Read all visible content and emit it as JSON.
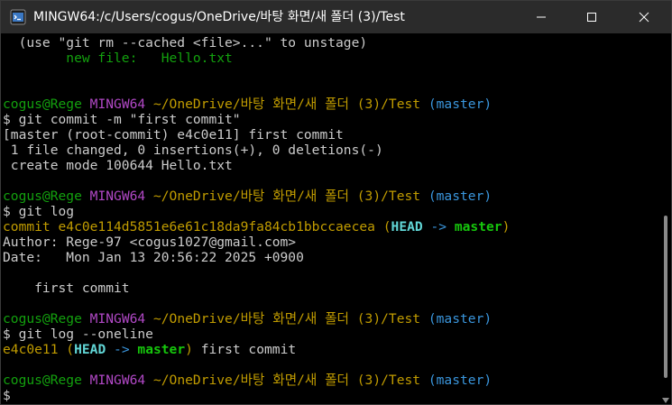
{
  "window": {
    "title": "MINGW64:/c/Users/cogus/OneDrive/바탕 화면/새 폴더 (3)/Test",
    "app_icon": "mingw-terminal-icon",
    "buttons": {
      "minimize": "minimize-icon",
      "maximize": "maximize-icon",
      "close": "close-icon"
    }
  },
  "colors": {
    "background": "#000000",
    "text": "#cccccc",
    "user_host": "#13a10e",
    "mingw": "#b148c6",
    "path": "#c19c00",
    "branch": "#3a96dd",
    "head": "#61d6d6",
    "master": "#16c60c"
  },
  "terminal": {
    "unstage_hint": "  (use \"git rm --cached <file>...\" to unstage)",
    "new_file_label": "        new file:   ",
    "new_file_name": "Hello.txt",
    "prompts": [
      {
        "user_host": "cogus@Rege",
        "shell": "MINGW64",
        "path": "~/OneDrive/바탕 화면/새 폴더 (3)/Test",
        "branch": "(master)"
      },
      {
        "user_host": "cogus@Rege",
        "shell": "MINGW64",
        "path": "~/OneDrive/바탕 화면/새 폴더 (3)/Test",
        "branch": "(master)"
      },
      {
        "user_host": "cogus@Rege",
        "shell": "MINGW64",
        "path": "~/OneDrive/바탕 화면/새 폴더 (3)/Test",
        "branch": "(master)"
      },
      {
        "user_host": "cogus@Rege",
        "shell": "MINGW64",
        "path": "~/OneDrive/바탕 화면/새 폴더 (3)/Test",
        "branch": "(master)"
      }
    ],
    "cmd_commit": "$ git commit -m \"first commit\"",
    "commit_out_1": "[master (root-commit) e4c0e11] first commit",
    "commit_out_2": " 1 file changed, 0 insertions(+), 0 deletions(-)",
    "commit_out_3": " create mode 100644 Hello.txt",
    "cmd_log": "$ git log",
    "log_commit_prefix": "commit e4c0e114d5851e6e61c18da9fa84cb1bbccaecea",
    "log_open_paren": " (",
    "log_head": "HEAD",
    "log_arrow": " -> ",
    "log_master": "master",
    "log_close_paren": ")",
    "log_author": "Author: Rege-97 <cogus1027@gmail.com>",
    "log_date": "Date:   Mon Jan 13 20:56:22 2025 +0900",
    "log_message": "    first commit",
    "cmd_log_oneline": "$ git log --oneline",
    "oneline_hash": "e4c0e11",
    "oneline_open_paren": " (",
    "oneline_head": "HEAD",
    "oneline_arrow": " -> ",
    "oneline_master": "master",
    "oneline_close_paren": ")",
    "oneline_message": " first commit",
    "final_prompt": "$"
  }
}
